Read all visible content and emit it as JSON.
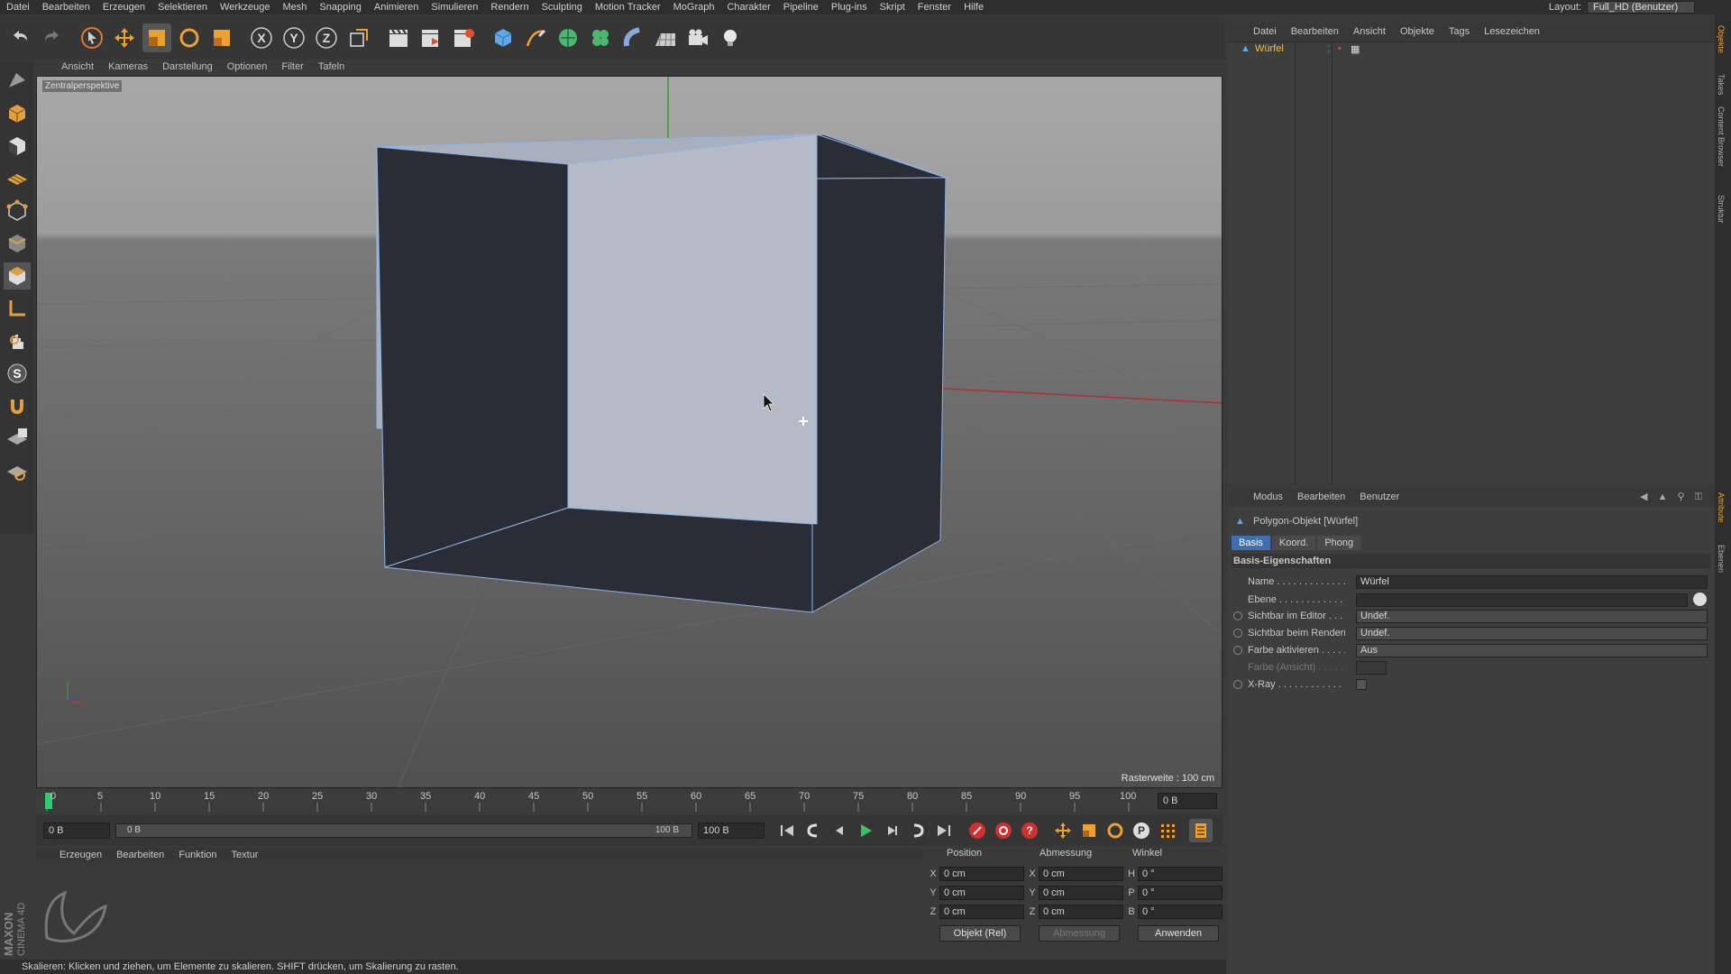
{
  "menubar": {
    "items": [
      "Datei",
      "Bearbeiten",
      "Erzeugen",
      "Selektieren",
      "Werkzeuge",
      "Mesh",
      "Snapping",
      "Animieren",
      "Simulieren",
      "Rendern",
      "Sculpting",
      "Motion Tracker",
      "MoGraph",
      "Charakter",
      "Pipeline",
      "Plug-ins",
      "Skript",
      "Fenster",
      "Hilfe"
    ],
    "layout_label": "Layout:",
    "layout_value": "Full_HD (Benutzer)"
  },
  "viewport": {
    "menu": [
      "Ansicht",
      "Kameras",
      "Darstellung",
      "Optionen",
      "Filter",
      "Tafeln"
    ],
    "camera_label": "Zentralperspektive",
    "raster": "Rasterweite : 100 cm"
  },
  "timeline": {
    "ticks": [
      "0",
      "5",
      "10",
      "15",
      "20",
      "25",
      "30",
      "35",
      "40",
      "45",
      "50",
      "55",
      "60",
      "65",
      "70",
      "75",
      "80",
      "85",
      "90",
      "95",
      "100"
    ],
    "current_frame": "0 B",
    "start": "0 B",
    "range_start": "0 B",
    "range_end": "100 B",
    "end": "100 B"
  },
  "material_manager": {
    "menu": [
      "Erzeugen",
      "Bearbeiten",
      "Funktion",
      "Textur"
    ],
    "brand_top": "MAXON",
    "brand_bottom": "CINEMA 4D"
  },
  "coordinates": {
    "headers": [
      "Position",
      "Abmessung",
      "Winkel"
    ],
    "rows": [
      {
        "axis": "X",
        "pos": "0 cm",
        "dim_axis": "X",
        "dim": "0 cm",
        "ang_axis": "H",
        "ang": "0 °"
      },
      {
        "axis": "Y",
        "pos": "0 cm",
        "dim_axis": "Y",
        "dim": "0 cm",
        "ang_axis": "P",
        "ang": "0 °"
      },
      {
        "axis": "Z",
        "pos": "0 cm",
        "dim_axis": "Z",
        "dim": "0 cm",
        "ang_axis": "B",
        "ang": "0 °"
      }
    ],
    "mode": "Objekt (Rel)",
    "size_mode": "Abmessung",
    "apply": "Anwenden"
  },
  "status": "Skalieren: Klicken und ziehen, um Elemente zu skalieren. SHIFT drücken, um Skalierung zu rasten.",
  "object_manager": {
    "menu": [
      "Datei",
      "Bearbeiten",
      "Ansicht",
      "Objekte",
      "Tags",
      "Lesezeichen"
    ],
    "object_name": "Würfel"
  },
  "attribute_manager": {
    "menu": [
      "Modus",
      "Bearbeiten",
      "Benutzer"
    ],
    "title": "Polygon-Objekt [Würfel]",
    "tabs": [
      "Basis",
      "Koord.",
      "Phong"
    ],
    "section": "Basis-Eigenschaften",
    "props": [
      {
        "label": "Name . . . . . . . . . . . . .",
        "value": "Würfel"
      },
      {
        "label": "Ebene . . . . . . . . . . . . .",
        "value": ""
      },
      {
        "label": "Sichtbar im Editor . . . .",
        "value": "Undef."
      },
      {
        "label": "Sichtbar beim Rendern",
        "value": "Undef."
      },
      {
        "label": "Farbe aktivieren . . . . .",
        "value": "Aus"
      },
      {
        "label": "Farbe (Ansicht) . . . . . .",
        "value": ""
      },
      {
        "label": "X-Ray . . . . . . . . . . . . .",
        "value": ""
      }
    ]
  },
  "side_tabs": [
    "Objekte",
    "Takes",
    "Content Browser",
    "Struktur",
    "Attribute",
    "Ebenen"
  ],
  "colors": {
    "accent": "#3e6fb0",
    "selection": "#8fb4e8",
    "playhead": "#2ecc71"
  }
}
